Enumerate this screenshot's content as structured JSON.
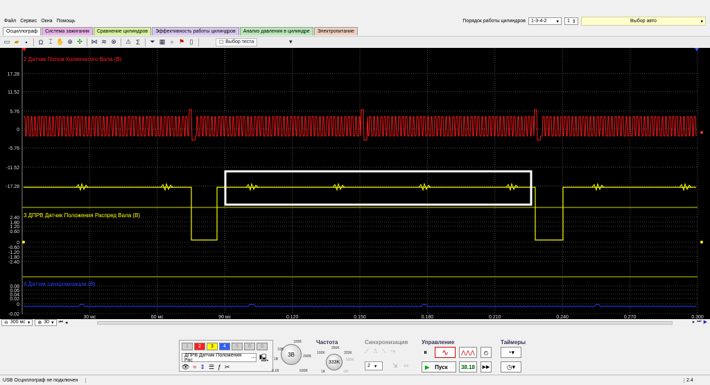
{
  "menu": [
    "Файл",
    "Сервис",
    "Окна",
    "Помощь"
  ],
  "cyl_order_label": "Порядок работы цилиндров",
  "cyl_order_value": "1-3-4-2",
  "cyl_num": "1",
  "auto_select": "Выбор авто",
  "tabs": [
    {
      "label": "Осциллограф",
      "color": "#ffffff"
    },
    {
      "label": "Система зажигания",
      "color": "#e8b4e8"
    },
    {
      "label": "Сравнение цилиндров",
      "color": "#d8f0a0"
    },
    {
      "label": "Эффективность работы цилиндров",
      "color": "#d8c8f0"
    },
    {
      "label": "Анализ давления в цилиндре",
      "color": "#b8e8b8"
    },
    {
      "label": "Электропитание",
      "color": "#f0d0c0"
    }
  ],
  "test_select": "Выбор теста",
  "channels": {
    "ch2": {
      "title": "2 Датчик Полож Коленчатого Вала (В)",
      "color": "#ff2020",
      "ticks": [
        "17.28",
        "11.52",
        "5.76",
        "0",
        "-5.76",
        "-11.52",
        "-17.28"
      ]
    },
    "ch3": {
      "title": "3 ДПРВ Датчик Положения Распред Вала (В)",
      "color": "#ffff00",
      "ticks": [
        "2.40",
        "1.80",
        "1.20",
        "0.60",
        "0",
        "-0.60",
        "-1.20",
        "-1.80",
        "-2.40"
      ]
    },
    "ch4": {
      "title": "4 Датчик синхронизации (В)",
      "color": "#2040ff",
      "ticks": [
        "0.08",
        "0.06",
        "0.04",
        "0.02",
        "0",
        "-0.02"
      ]
    }
  },
  "time_labels": [
    "30 мс",
    "60 мс",
    "90 мс",
    "0.120",
    "0.150",
    "0.180",
    "0.210",
    "0.240",
    "0.270",
    "0.300"
  ],
  "timebase": "300 мс",
  "zoom": "30",
  "channel_buttons": [
    "1",
    "2",
    "3",
    "4",
    "5",
    "6",
    "0"
  ],
  "channel_colors": [
    "#d0d0d0",
    "#ff2020",
    "#ffff00",
    "#3060ff",
    "#d0d0d0",
    "#d0d0d0",
    "#d0d0d0"
  ],
  "channel_select": "ДПРВ Датчик Положения Рас",
  "volt_knob": {
    "center": "3В",
    "labels": [
      "10В",
      "100В",
      "200В",
      "500В",
      "0.1В",
      "1В"
    ]
  },
  "freq": {
    "title": "Частота",
    "center": "333K",
    "labels": [
      "250K",
      "100K",
      "333K",
      "500K",
      "1M",
      "1K"
    ]
  },
  "sync": {
    "title": "Синхронизация",
    "value": "2"
  },
  "control": {
    "title": "Управление",
    "start": "Пуск",
    "value": "38.18"
  },
  "timers": {
    "title": "Таймеры"
  },
  "status_left": "USB Осциллограф не подключен",
  "status_right": "2.4"
}
